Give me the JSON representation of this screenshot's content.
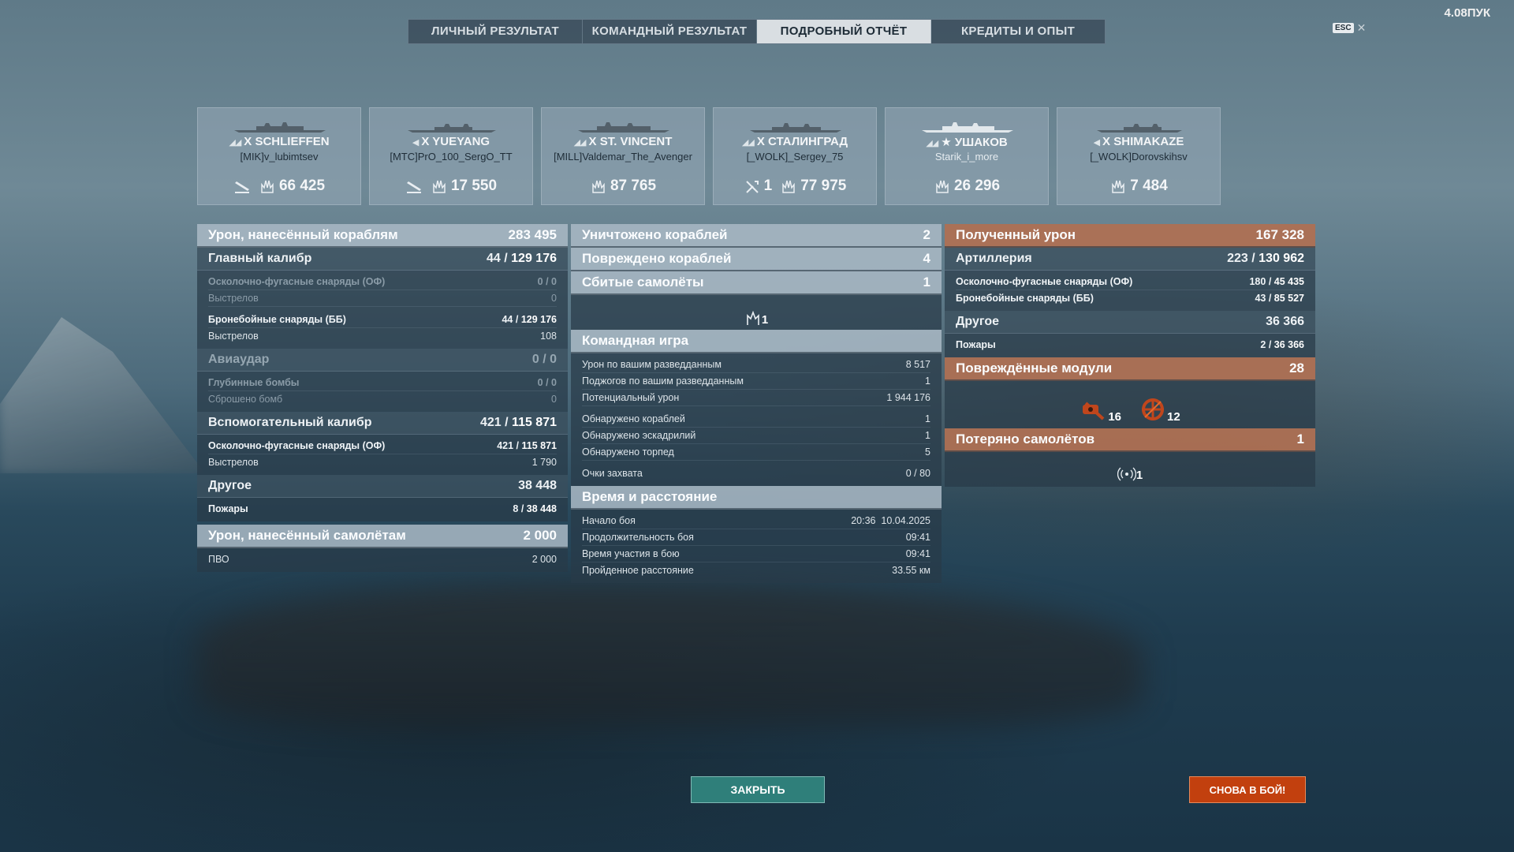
{
  "top_right": "4.08ПУК",
  "esc": {
    "key": "ESC",
    "close": "✕"
  },
  "tabs": [
    {
      "label": "ЛИЧНЫЙ РЕЗУЛЬТАТ"
    },
    {
      "label": "КОМАНДНЫЙ РЕЗУЛЬТАТ"
    },
    {
      "label": "ПОДРОБНЫЙ ОТЧЁТ",
      "active": true
    },
    {
      "label": "КРЕДИТЫ И ОПЫТ"
    }
  ],
  "ships": [
    {
      "tier": "X",
      "name": "SCHLIEFFEN",
      "player": "[MIK]v_lubimtsev",
      "stat_a": "",
      "damage": "66 425",
      "class_icon": "battleship-icon"
    },
    {
      "tier": "X",
      "name": "YUEYANG",
      "player": "[MTC]PrO_100_SergO_TT",
      "stat_a": "",
      "damage": "17 550",
      "class_icon": "destroyer-icon"
    },
    {
      "tier": "X",
      "name": "ST. VINCENT",
      "player": "[MILL]Valdemar_The_Avenger",
      "damage": "87 765",
      "class_icon": "battleship-icon"
    },
    {
      "tier": "X",
      "name": "СТАЛИНГРАД",
      "player": "[_WOLK]_Sergey_75",
      "stat_a": "1",
      "damage": "77 975",
      "class_icon": "cruiser-icon"
    },
    {
      "tier": "★",
      "name": "УШАКОВ",
      "player": "Starik_i_more",
      "damage": "26 296",
      "class_icon": "battleship-icon"
    },
    {
      "tier": "X",
      "name": "SHIMAKAZE",
      "player": "[_WOLK]Dorovskihsv",
      "damage": "7 484",
      "class_icon": "destroyer-icon"
    }
  ],
  "left": {
    "header": {
      "label": "Урон, нанесённый кораблям",
      "value": "283 495"
    },
    "main_caliber": {
      "label": "Главный калибр",
      "hits": "44",
      "dmg": "129 176"
    },
    "he_shells": {
      "label": "Осколочно-фугасные снаряды (ОФ)",
      "value": "0 / 0"
    },
    "he_shots": {
      "label": "Выстрелов",
      "value": "0"
    },
    "ap_shells": {
      "label": "Бронебойные снаряды (ББ)",
      "hits": "44",
      "dmg": "129 176"
    },
    "ap_shots": {
      "label": "Выстрелов",
      "value": "108"
    },
    "airstrike": {
      "label": "Авиаудар",
      "value": "0 / 0"
    },
    "depth": {
      "label": "Глубинные бомбы",
      "value": "0 / 0"
    },
    "bombs": {
      "label": "Сброшено бомб",
      "value": "0"
    },
    "secondary": {
      "label": "Вспомогательный калибр",
      "hits": "421",
      "dmg": "115 871"
    },
    "sec_he": {
      "label": "Осколочно-фугасные снаряды (ОФ)",
      "hits": "421",
      "dmg": "115 871"
    },
    "sec_shots": {
      "label": "Выстрелов",
      "value": "1 790"
    },
    "other": {
      "label": "Другое",
      "value": "38 448"
    },
    "fires": {
      "label": "Пожары",
      "hits": "8",
      "dmg": "38 448"
    },
    "air_header": {
      "label": "Урон, нанесённый самолётам",
      "value": "2 000"
    },
    "aa": {
      "label": "ПВО",
      "value": "2 000"
    }
  },
  "middle": {
    "destroyed": {
      "label": "Уничтожено кораблей",
      "value": "2"
    },
    "damaged": {
      "label": "Повреждено кораблей",
      "value": "4"
    },
    "planes": {
      "label": "Сбитые самолёты",
      "value": "1"
    },
    "planes_icon_count": "1",
    "team": {
      "label": "Командная игра"
    },
    "team_rows_a": [
      {
        "label": "Урон по вашим разведданным",
        "value": "8 517"
      },
      {
        "label": "Поджогов по вашим разведданным",
        "value": "1"
      },
      {
        "label": "Потенциальный урон",
        "value": "1 944 176"
      }
    ],
    "team_rows_b": [
      {
        "label": "Обнаружено кораблей",
        "value": "1"
      },
      {
        "label": "Обнаружено эскадрилий",
        "value": "1"
      },
      {
        "label": "Обнаружено торпед",
        "value": "5"
      }
    ],
    "capture": {
      "label": "Очки захвата",
      "value": "0 / 80"
    },
    "time": {
      "label": "Время и расстояние"
    },
    "time_rows": [
      {
        "label": "Начало боя",
        "value": "20:36  10.04.2025"
      },
      {
        "label": "Продолжительность боя",
        "value": "09:41"
      },
      {
        "label": "Время участия в бою",
        "value": "09:41"
      },
      {
        "label": "Пройденное расстояние",
        "value": "33.55 км"
      }
    ]
  },
  "right": {
    "header": {
      "label": "Полученный урон",
      "value": "167 328"
    },
    "artillery": {
      "label": "Артиллерия",
      "hits": "223",
      "dmg": "130 962"
    },
    "he": {
      "label": "Осколочно-фугасные снаряды (ОФ)",
      "hits": "180",
      "dmg": "45 435"
    },
    "ap": {
      "label": "Бронебойные снаряды (ББ)",
      "hits": "43",
      "dmg": "85 527"
    },
    "other": {
      "label": "Другое",
      "value": "36 366"
    },
    "fires": {
      "label": "Пожары",
      "hits": "2",
      "dmg": "36 366"
    },
    "modules": {
      "label": "Повреждённые модули",
      "value": "28"
    },
    "module_counts": {
      "guns": "16",
      "steering": "12"
    },
    "planes_lost": {
      "label": "Потеряно самолётов",
      "value": "1"
    },
    "planes_lost_count": "1"
  },
  "buttons": {
    "close": "ЗАКРЫТЬ",
    "battle": "СНОВА В БОЙ!"
  },
  "colors": {
    "accent_orange": "#b07052",
    "close_teal": "#2f7f7a",
    "battle_orange": "#c2400e"
  }
}
